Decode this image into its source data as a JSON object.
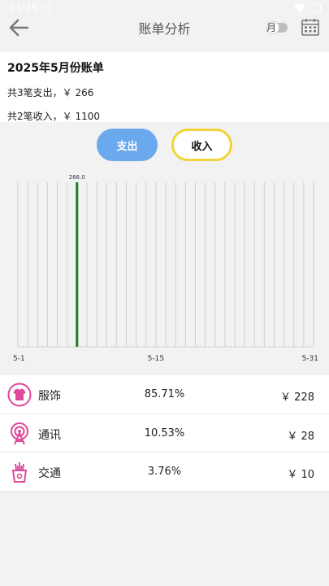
{
  "status": {
    "time": "11:45"
  },
  "header": {
    "title": "账单分析",
    "toggle_label": "月"
  },
  "summary": {
    "heading": "2025年5月份账单",
    "expense_line": "共3笔支出，￥ 266",
    "income_line": "共2笔收入，￥ 1100"
  },
  "buttons": {
    "expense": "支出",
    "income": "收入"
  },
  "colors": {
    "accent_blue": "#6aa9ee",
    "accent_yellow": "#f0d43a",
    "bar_green": "#1e7a1e",
    "icon_pink": "#e0489a"
  },
  "chart_data": {
    "type": "bar",
    "days": 31,
    "x_tick_labels": [
      "5-1",
      "5-15",
      "5-31"
    ],
    "values": [
      0,
      0,
      0,
      0,
      0,
      0,
      266,
      0,
      0,
      0,
      0,
      0,
      0,
      0,
      0,
      0,
      0,
      0,
      0,
      0,
      0,
      0,
      0,
      0,
      0,
      0,
      0,
      0,
      0,
      0,
      0
    ],
    "value_label": "266.0",
    "ylim": [
      0,
      266
    ]
  },
  "categories": [
    {
      "icon": "tshirt-icon",
      "name": "服饰",
      "percent": "85.71%",
      "amount": "￥ 228"
    },
    {
      "icon": "signal-tower-icon",
      "name": "通讯",
      "percent": "10.53%",
      "amount": "￥ 28"
    },
    {
      "icon": "transit-icon",
      "name": "交通",
      "percent": "3.76%",
      "amount": "￥ 10"
    }
  ]
}
